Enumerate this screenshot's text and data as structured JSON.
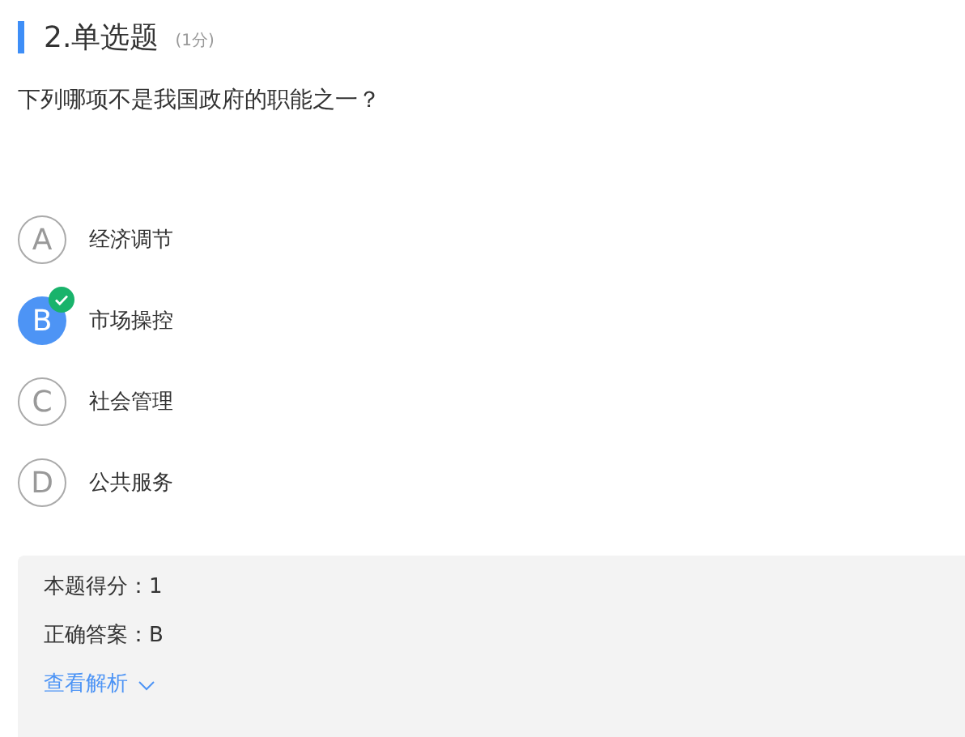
{
  "question": {
    "title": "2.单选题",
    "points": "(1分)",
    "text": "下列哪项不是我国政府的职能之一？"
  },
  "options": [
    {
      "letter": "A",
      "text": "经济调节",
      "selected": false,
      "correct": false
    },
    {
      "letter": "B",
      "text": "市场操控",
      "selected": true,
      "correct": true
    },
    {
      "letter": "C",
      "text": "社会管理",
      "selected": false,
      "correct": false
    },
    {
      "letter": "D",
      "text": "公共服务",
      "selected": false,
      "correct": false
    }
  ],
  "result": {
    "score": "本题得分：1",
    "answer": "正确答案：B",
    "analysis_link": "查看解析"
  }
}
